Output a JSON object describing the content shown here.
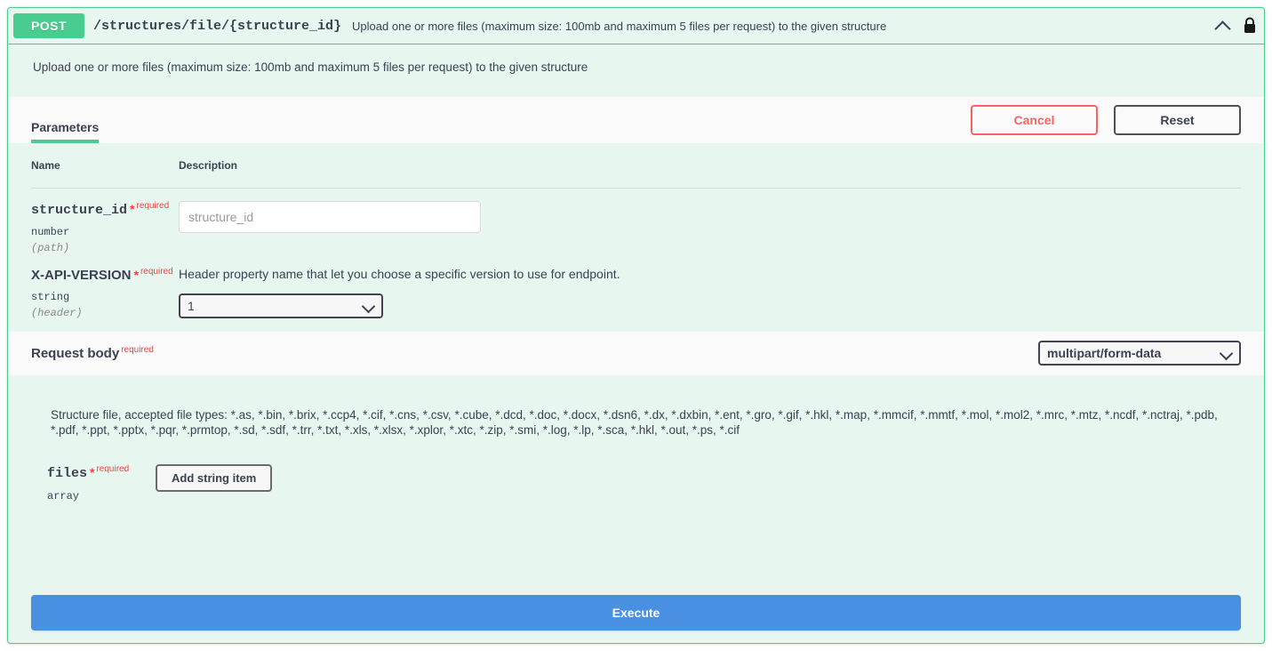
{
  "operation": {
    "method": "POST",
    "path": "/structures/file/{structure_id}",
    "summary": "Upload one or more files (maximum size: 100mb and maximum 5 files per request) to the given structure",
    "description": "Upload one or more files (maximum size: 100mb and maximum 5 files per request) to the given structure",
    "collapse_icon": "chevron-up-icon",
    "auth_icon": "lock-icon",
    "method_color": "#49cc90",
    "border_color": "#49cc90",
    "background_color": "#e8f6f0"
  },
  "tabs": [
    {
      "label": "Parameters",
      "active": true
    }
  ],
  "toolbar": {
    "cancel_label": "Cancel",
    "reset_label": "Reset",
    "cancel_color": "#ff6060",
    "reset_color": "#4f4f4f"
  },
  "parameters_table": {
    "headers": {
      "name": "Name",
      "description": "Description"
    },
    "rows": [
      {
        "name": "structure_id",
        "required_marker": "*",
        "required_label": "required",
        "type": "number",
        "in": "(path)",
        "description": "",
        "control": "text-input",
        "value": "",
        "placeholder": "structure_id"
      },
      {
        "name": "X-API-VERSION",
        "required_marker": "*",
        "required_label": "required",
        "type": "string",
        "in": "(header)",
        "description": "Header property name that let you choose a specific version to use for endpoint.",
        "control": "select",
        "value": "1",
        "options": [
          "1"
        ]
      }
    ]
  },
  "request_body": {
    "title": "Request body",
    "required_label": "required",
    "media_type": "multipart/form-data",
    "media_type_options": [
      "multipart/form-data"
    ],
    "file_types_description": "Structure file, accepted file types: *.as, *.bin, *.brix, *.ccp4, *.cif, *.cns, *.csv, *.cube, *.dcd, *.doc, *.docx, *.dsn6, *.dx, *.dxbin, *.ent, *.gro, *.gif, *.hkl, *.map, *.mmcif, *.mmtf, *.mol, *.mol2, *.mrc, *.mtz, *.ncdf, *.nctraj, *.pdb, *.pdf, *.ppt, *.pptx, *.pqr, *.prmtop, *.sd, *.sdf, *.trr, *.txt, *.xls, *.xlsx, *.xplor, *.xtc, *.zip, *.smi, *.log, *.lp, *.sca, *.hkl, *.out, *.ps, *.cif",
    "field": {
      "name": "files",
      "required_marker": "*",
      "required_label": "required",
      "type": "array",
      "add_item_label": "Add string item"
    }
  },
  "execute": {
    "label": "Execute",
    "color": "#4990e2"
  }
}
